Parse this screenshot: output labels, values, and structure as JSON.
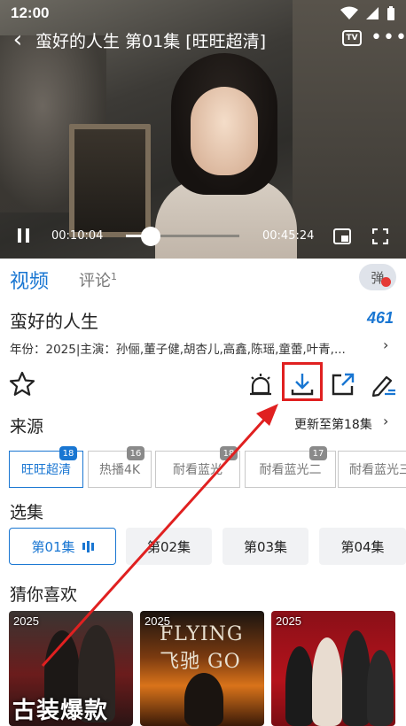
{
  "status_bar": {
    "time": "12:00"
  },
  "player": {
    "title": "蛮好的人生 第01集 [旺旺超清]",
    "tv_label": "TV",
    "more_label": "•••",
    "current_time": "00:10:04",
    "duration": "00:45:24",
    "progress_fraction": 0.22
  },
  "tabs": {
    "video": "视频",
    "comment": "评论",
    "comment_count": "1",
    "danmu": "弹"
  },
  "show": {
    "title": "蛮好的人生",
    "score": "461",
    "meta": "年份：2025|主演：孙俪,董子健,胡杏儿,高鑫,陈瑶,童蕾,叶青,..."
  },
  "actions": {
    "favorite_icon": "star-icon",
    "alarm_icon": "alarm-icon",
    "download_icon": "download-icon",
    "share_icon": "share-icon",
    "edit_icon": "edit-icon",
    "highlight_color": "#e02020"
  },
  "source": {
    "label": "来源",
    "update": "更新至第18集",
    "items": [
      {
        "label": "旺旺超清",
        "count": "18",
        "active": true
      },
      {
        "label": "热播4K",
        "count": "16",
        "active": false
      },
      {
        "label": "耐看蓝光",
        "count": "18",
        "active": false
      },
      {
        "label": "耐看蓝光二",
        "count": "17",
        "active": false
      },
      {
        "label": "耐看蓝光三",
        "count": "",
        "active": false
      }
    ]
  },
  "episodes": {
    "label": "选集",
    "items": [
      {
        "label": "第01集",
        "active": true
      },
      {
        "label": "第02集",
        "active": false
      },
      {
        "label": "第03集",
        "active": false
      },
      {
        "label": "第04集",
        "active": false
      }
    ]
  },
  "recommend": {
    "label": "猜你喜欢",
    "items": [
      {
        "year": "2025",
        "overlay": "古装爆款"
      },
      {
        "year": "2025",
        "overlay": "FLYING 飞驰 GO"
      },
      {
        "year": "2025",
        "overlay": ""
      }
    ]
  },
  "colors": {
    "accent": "#1976d2",
    "annotation_red": "#e02020"
  }
}
